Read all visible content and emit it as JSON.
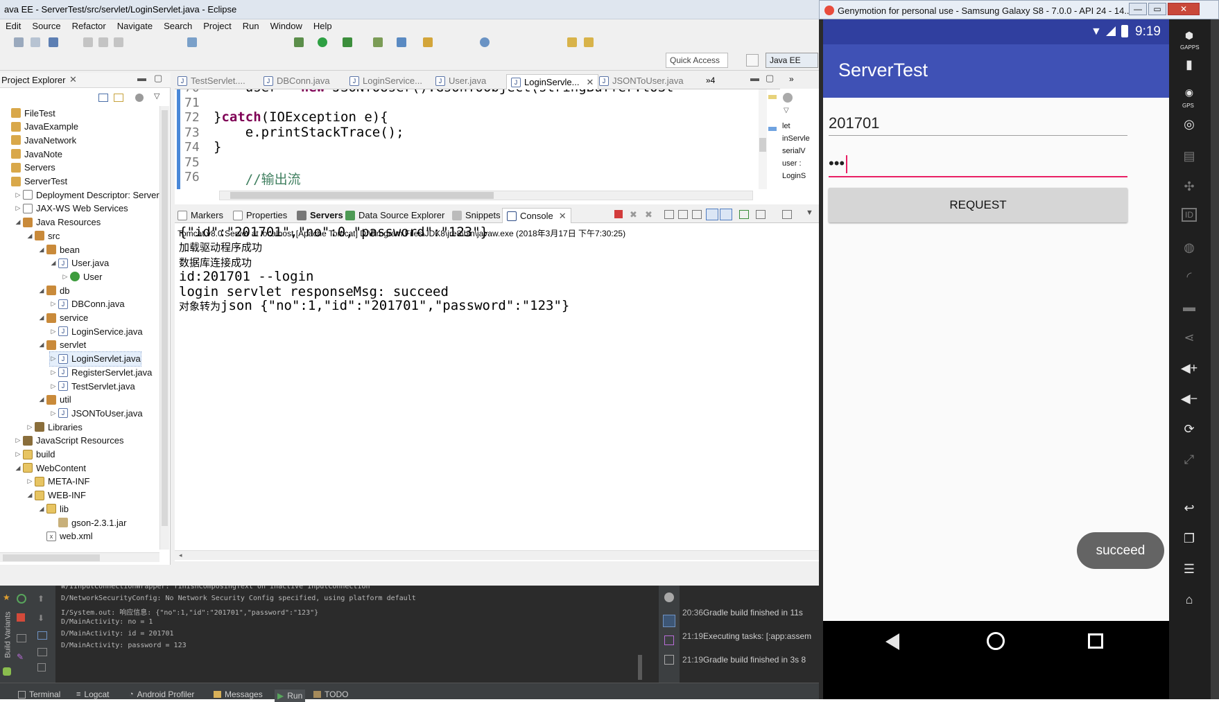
{
  "eclipse": {
    "window_title": "ava EE - ServerTest/src/servlet/LoginServlet.java - Eclipse",
    "menu": [
      "Edit",
      "Source",
      "Refactor",
      "Navigate",
      "Search",
      "Project",
      "Run",
      "Window",
      "Help"
    ],
    "quick_access": "Quick Access",
    "perspective": "Java EE",
    "project_explorer": {
      "tab": "Project Explorer",
      "tree": [
        {
          "label": "FileTest",
          "level": 0,
          "icon": "project-icon",
          "twisty": ""
        },
        {
          "label": "JavaExample",
          "level": 0,
          "icon": "project-icon",
          "twisty": ""
        },
        {
          "label": "JavaNetwork",
          "level": 0,
          "icon": "project-icon",
          "twisty": ""
        },
        {
          "label": "JavaNote",
          "level": 0,
          "icon": "project-icon",
          "twisty": ""
        },
        {
          "label": "Servers",
          "level": 0,
          "icon": "project-icon",
          "twisty": ""
        },
        {
          "label": "ServerTest",
          "level": 0,
          "icon": "project-icon",
          "twisty": ""
        },
        {
          "label": "Deployment Descriptor: ServerT",
          "level": 1,
          "icon": "descriptor-icon",
          "twisty": "▷"
        },
        {
          "label": "JAX-WS Web Services",
          "level": 1,
          "icon": "webservice-icon",
          "twisty": "▷"
        },
        {
          "label": "Java Resources",
          "level": 1,
          "icon": "java-resources-icon",
          "twisty": "◢"
        },
        {
          "label": "src",
          "level": 2,
          "icon": "source-folder-icon",
          "twisty": "◢"
        },
        {
          "label": "bean",
          "level": 3,
          "icon": "package-icon",
          "twisty": "◢"
        },
        {
          "label": "User.java",
          "level": 4,
          "icon": "java-file-icon",
          "twisty": "◢"
        },
        {
          "label": "User",
          "level": 5,
          "icon": "class-icon",
          "twisty": "▷"
        },
        {
          "label": "db",
          "level": 3,
          "icon": "package-icon",
          "twisty": "◢"
        },
        {
          "label": "DBConn.java",
          "level": 4,
          "icon": "java-file-icon",
          "twisty": "▷"
        },
        {
          "label": "service",
          "level": 3,
          "icon": "package-icon",
          "twisty": "◢"
        },
        {
          "label": "LoginService.java",
          "level": 4,
          "icon": "java-file-icon",
          "twisty": "▷"
        },
        {
          "label": "servlet",
          "level": 3,
          "icon": "package-icon",
          "twisty": "◢"
        },
        {
          "label": "LoginServlet.java",
          "level": 4,
          "icon": "java-file-icon",
          "twisty": "▷",
          "selected": true
        },
        {
          "label": "RegisterServlet.java",
          "level": 4,
          "icon": "java-file-icon",
          "twisty": "▷"
        },
        {
          "label": "TestServlet.java",
          "level": 4,
          "icon": "java-file-icon",
          "twisty": "▷"
        },
        {
          "label": "util",
          "level": 3,
          "icon": "package-icon",
          "twisty": "◢"
        },
        {
          "label": "JSONToUser.java",
          "level": 4,
          "icon": "java-file-icon",
          "twisty": "▷"
        },
        {
          "label": "Libraries",
          "level": 2,
          "icon": "library-icon",
          "twisty": "▷"
        },
        {
          "label": "JavaScript Resources",
          "level": 1,
          "icon": "javascript-resources-icon",
          "twisty": "▷"
        },
        {
          "label": "build",
          "level": 1,
          "icon": "folder-icon",
          "twisty": "▷"
        },
        {
          "label": "WebContent",
          "level": 1,
          "icon": "folder-icon",
          "twisty": "◢"
        },
        {
          "label": "META-INF",
          "level": 2,
          "icon": "folder-icon",
          "twisty": "▷"
        },
        {
          "label": "WEB-INF",
          "level": 2,
          "icon": "folder-icon",
          "twisty": "◢"
        },
        {
          "label": "lib",
          "level": 3,
          "icon": "folder-icon",
          "twisty": "◢"
        },
        {
          "label": "gson-2.3.1.jar",
          "level": 4,
          "icon": "jar-icon",
          "twisty": ""
        },
        {
          "label": "web.xml",
          "level": 3,
          "icon": "xml-file-icon",
          "twisty": ""
        }
      ]
    },
    "editor": {
      "tabs": [
        "TestServlet....",
        "DBConn.java",
        "LoginService...",
        "User.java",
        "LoginServle...",
        "JSONToUser.java"
      ],
      "active_tab": 4,
      "overflow_count": "»4",
      "lines": [
        {
          "num": "70",
          "code": "    user = new JSONToUser().GsonToObject(stringBuffer.toSt"
        },
        {
          "num": "71",
          "code": ""
        },
        {
          "num": "72",
          "code": "}catch(IOException e){",
          "kw": "catch"
        },
        {
          "num": "73",
          "code": "    e.printStackTrace();"
        },
        {
          "num": "74",
          "code": "}"
        },
        {
          "num": "75",
          "code": ""
        },
        {
          "num": "76",
          "code": "    //输出流"
        }
      ]
    },
    "outline_fragments": [
      "let",
      "inServle",
      "serialV",
      "user :",
      "LoginS"
    ],
    "console": {
      "tabs": [
        "Markers",
        "Properties",
        "Servers",
        "Data Source Explorer",
        "Snippets",
        "Console"
      ],
      "active_tab": 5,
      "description": "Tomcat v8.0 Server at localhost [Apache Tomcat] D:\\Program Files\\JDK8\\jre8\\bin\\javaw.exe (2018年3月17日 下午7:30:25)",
      "lines": [
        {
          "text": "{\"id\":\"201701\",\"no\":0,\"password\":\"123\"}",
          "style": "mono"
        },
        {
          "text": "加载驱动程序成功",
          "style": "cjk"
        },
        {
          "text": "数据库连接成功",
          "style": "cjk"
        },
        {
          "text": "id:201701 --login",
          "style": "mono"
        },
        {
          "text": "login servlet responseMsg: succeed",
          "style": "mono"
        }
      ],
      "last_line_prefix": "对象转为",
      "last_line_rest": "json {\"no\":1,\"id\":\"201701\",\"password\":\"123\"}"
    }
  },
  "android_studio": {
    "log_lines": [
      "W/IInputConnectionWrapper: finishComposingText on inactive InputConnection",
      "D/NetworkSecurityConfig: No Network Security Config specified, using platform default",
      "I/System.out: 响应信息: {\"no\":1,\"id\":\"201701\",\"password\":\"123\"}",
      "D/MainActivity: no = 1",
      "D/MainActivity: id = 201701",
      "D/MainActivity: password = 123"
    ],
    "events": [
      {
        "time": "20:36",
        "text": "Gradle build finished in 11s"
      },
      {
        "time": "21:19",
        "text": "Executing tasks: [:app:assem"
      },
      {
        "time": "21:19",
        "text": "Gradle build finished in 3s 8"
      }
    ],
    "side_label": "Build Variants",
    "status_tabs": [
      "Terminal",
      "Logcat",
      "Android Profiler",
      "Messages",
      "Run",
      "TODO"
    ]
  },
  "genymotion": {
    "window_title": "Genymotion for personal use - Samsung Galaxy S8 - 7.0.0 - API 24 - 14...",
    "status_time": "9:19",
    "app_title": "ServerTest",
    "id_value": "201701",
    "password_value": "•••",
    "request_label": "REQUEST",
    "toast": "succeed",
    "side_icons": [
      "gapps-icon",
      "battery-icon",
      "gps-icon",
      "camera-icon",
      "video-icon",
      "dpad-icon",
      "id-icon",
      "disk-icon",
      "rss-icon",
      "sms-icon",
      "share-icon",
      "volume-up-icon",
      "volume-down-icon",
      "rotate-icon",
      "scale-icon",
      "back-icon",
      "recent-apps-icon",
      "menu-icon",
      "home-icon"
    ],
    "gapps_label": "GAPPS",
    "gps_label": "GPS"
  }
}
